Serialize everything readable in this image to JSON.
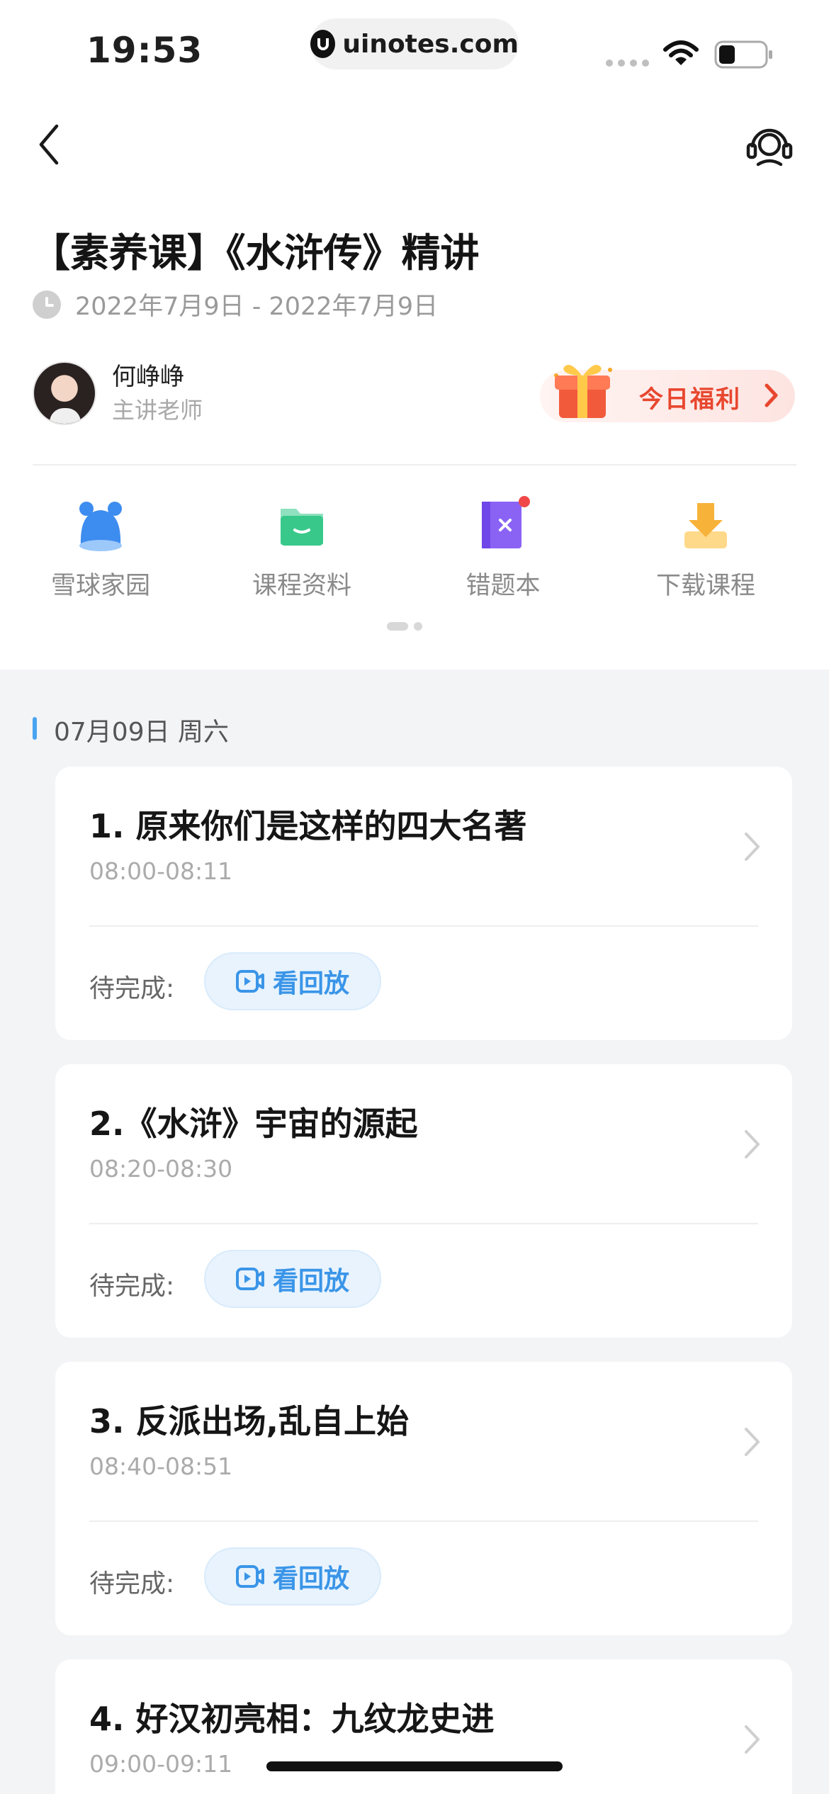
{
  "status_bar": {
    "time": "19:53",
    "url": "uinotes.com"
  },
  "course": {
    "title": "【素养课】《水浒传》精讲",
    "date_range": "2022年7月9日 - 2022年7月9日",
    "teacher_name": "何峥峥",
    "teacher_role": "主讲老师",
    "welfare_label": "今日福利"
  },
  "quick_actions": [
    {
      "label": "雪球家园",
      "icon": "snowball-mascot-icon"
    },
    {
      "label": "课程资料",
      "icon": "folder-icon"
    },
    {
      "label": "错题本",
      "icon": "wrong-book-icon"
    },
    {
      "label": "下载课程",
      "icon": "download-icon"
    }
  ],
  "section": {
    "date": "07月09日 周六"
  },
  "lessons": [
    {
      "title": "1. 原来你们是这样的四大名著",
      "time": "08:00-08:11",
      "status": "待完成:",
      "action": "看回放"
    },
    {
      "title": "2.《水浒》宇宙的源起",
      "time": "08:20-08:30",
      "status": "待完成:",
      "action": "看回放"
    },
    {
      "title": "3. 反派出场,乱自上始",
      "time": "08:40-08:51",
      "status": "待完成:",
      "action": "看回放"
    },
    {
      "title": "4. 好汉初亮相：九纹龙史进",
      "time": "09:00-09:11",
      "status": "",
      "action": ""
    }
  ],
  "colors": {
    "accent": "#3a95e8",
    "welfare": "#e8472f",
    "background": "#f3f4f6"
  }
}
